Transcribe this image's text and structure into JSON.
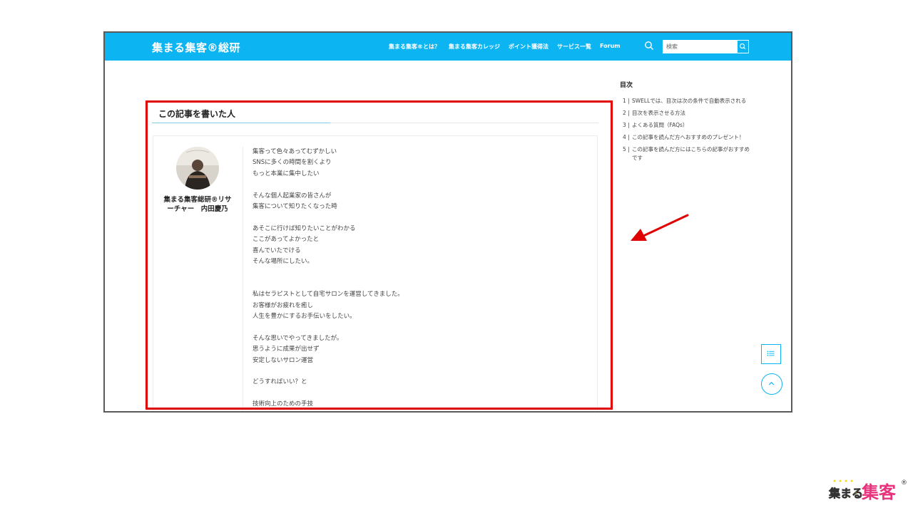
{
  "header": {
    "brand": "集まる集客®総研",
    "nav": [
      "集まる集客®とは？",
      "集まる集客カレッジ",
      "ポイント獲得法",
      "サービス一覧",
      "Forum"
    ],
    "search_placeholder": "検索"
  },
  "author_section": {
    "title": "この記事を書いた人",
    "name": "集まる集客総研®リサーチャー　内田慶乃",
    "bio_lines": [
      "集客って色々あってむずかしい",
      "SNSに多くの時間を割くより",
      "もっと本業に集中したい",
      "",
      "そんな個人起業家の皆さんが",
      "集客について知りたくなった時",
      "",
      "あそこに行けば知りたいことがわかる",
      "ここがあってよかったと",
      "喜んでいたでける",
      "そんな場所にしたい。",
      "",
      "",
      "私はセラピストとして自宅サロンを運営してきました。",
      "お客様がお疲れを癒し",
      "人生を豊かにするお手伝いをしたい。",
      "",
      "そんな思いでやってきましたが。",
      "思うように成果が出せず",
      "安定しないサロン運営",
      "",
      "どうすればいい？と",
      "",
      "技術向上のための手技"
    ]
  },
  "toc": {
    "title": "目次",
    "items": [
      {
        "num": "1 |",
        "text": "SWELLでは、目次は次の条件で自動表示される"
      },
      {
        "num": "2 |",
        "text": "目次を表示させる方法"
      },
      {
        "num": "3 |",
        "text": "よくある質問（FAQs）"
      },
      {
        "num": "4 |",
        "text": "この記事を読んだ方へおすすめのプレゼント！"
      },
      {
        "num": "5 |",
        "text": "この記事を読んだ方にはこちらの記事がおすすめです"
      }
    ]
  },
  "logo": {
    "text_black": "集まる",
    "text_pink": "集客",
    "mark": "®"
  },
  "colors": {
    "header_bg": "#0db4f2",
    "highlight": "#e00000",
    "logo_pink": "#e8327c",
    "logo_yellow": "#ffd400"
  }
}
